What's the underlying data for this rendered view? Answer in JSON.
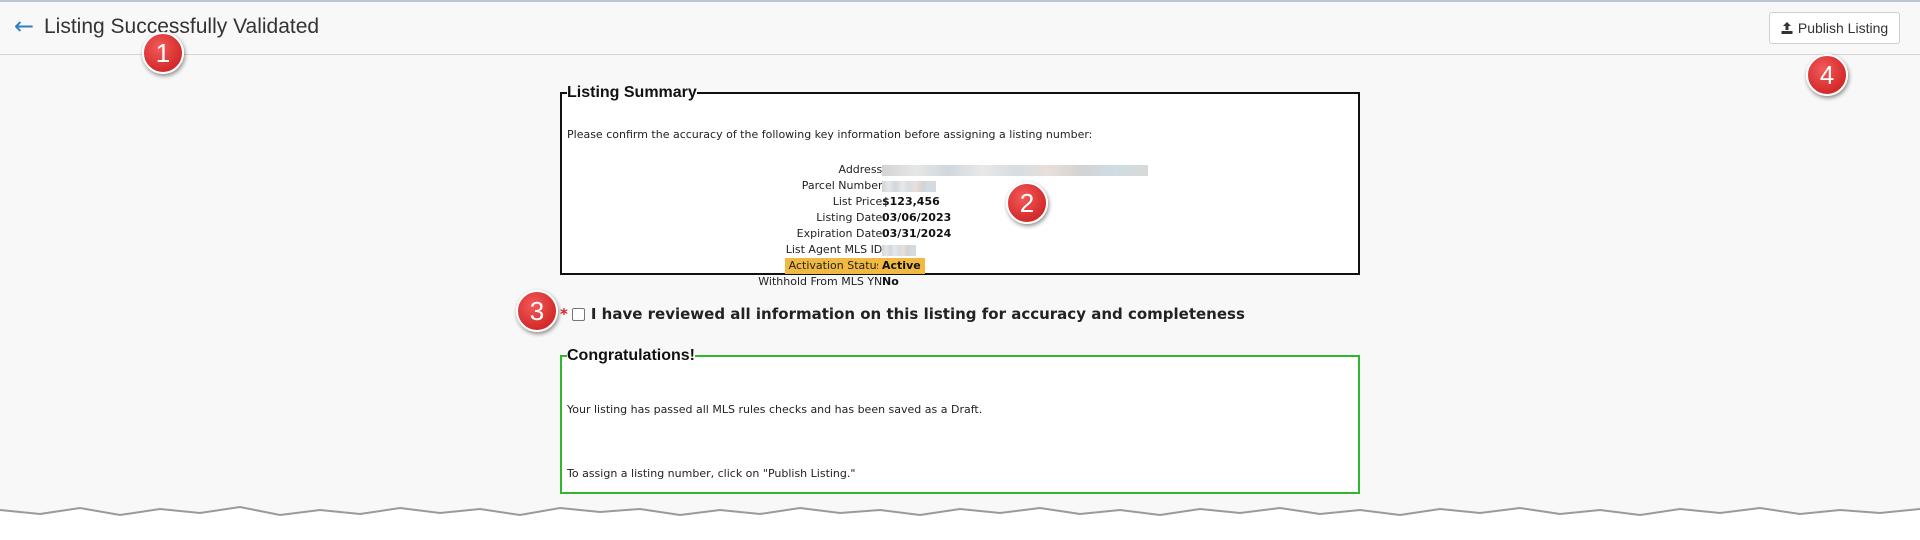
{
  "header": {
    "title": "Listing Successfully Validated",
    "publish_label": "Publish Listing"
  },
  "summary": {
    "legend": "Listing Summary",
    "intro": "Please confirm the accuracy of the following key information before assigning a listing number:",
    "rows": [
      {
        "label": "Address:",
        "value": ""
      },
      {
        "label": "Parcel Number:",
        "value": ""
      },
      {
        "label": "List Price:",
        "value": "$123,456"
      },
      {
        "label": "Listing Date:",
        "value": "03/06/2023"
      },
      {
        "label": "Expiration Date:",
        "value": "03/31/2024"
      },
      {
        "label": "List Agent MLS ID:",
        "value": ""
      },
      {
        "label": "Activation Status:",
        "value": "Active"
      },
      {
        "label": "Withhold From MLS YN:",
        "value": "No"
      }
    ]
  },
  "confirm": {
    "required_mark": "*",
    "label": "I have reviewed all information on this listing for accuracy and completeness",
    "checked": false
  },
  "congrats": {
    "legend": "Congratulations!",
    "line1": "Your listing has passed all MLS rules checks and has been saved as a Draft.",
    "line2": "To assign a listing number, click on \"Publish Listing.\""
  },
  "callouts": [
    "1",
    "2",
    "3",
    "4"
  ],
  "colors": {
    "accent_blue": "#2d7fc4",
    "highlight": "#f1b93f",
    "success_border": "#2fb82f",
    "callout_red": "#d42a2a"
  },
  "icons": {
    "back": "arrow-left-icon",
    "publish": "upload-icon"
  }
}
